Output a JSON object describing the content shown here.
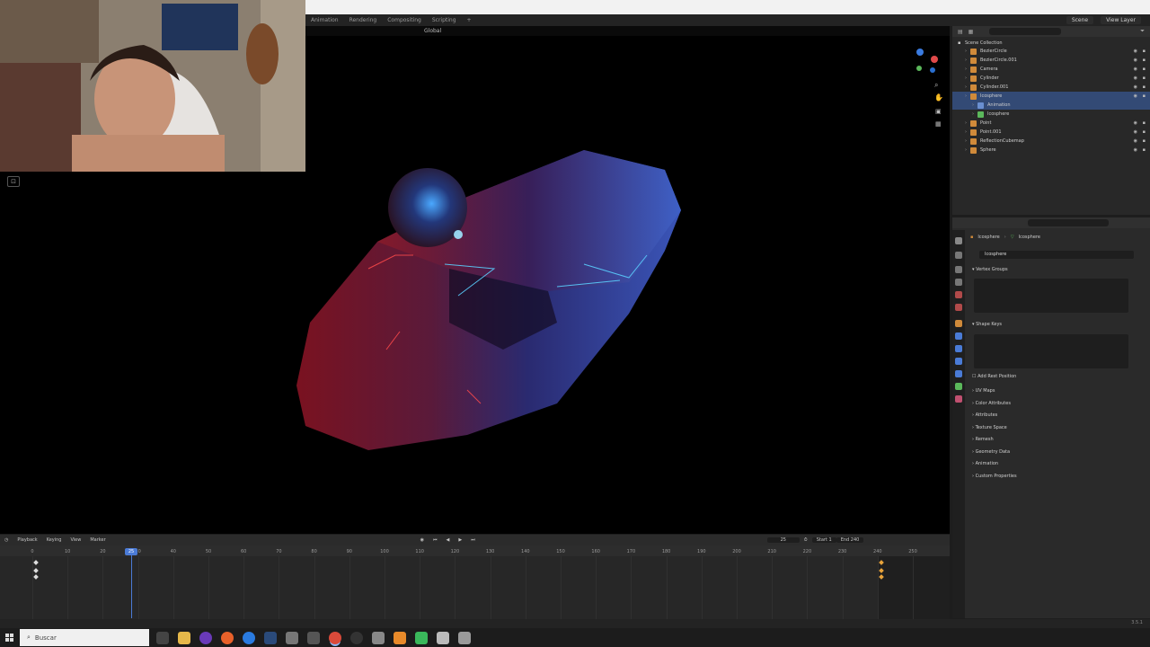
{
  "menubar": {
    "tabs": [
      "Animation",
      "Rendering",
      "Compositing",
      "Scripting",
      "+"
    ],
    "scene": "Scene",
    "view_layer": "View Layer"
  },
  "viewport_header": {
    "transform": "Global"
  },
  "outliner": {
    "search_placeholder": "",
    "root": "Scene Collection",
    "items": [
      {
        "name": "BezierCircle",
        "color": "#d08a3a",
        "selected": false,
        "level": 1
      },
      {
        "name": "BezierCircle.001",
        "color": "#d08a3a",
        "selected": false,
        "level": 1
      },
      {
        "name": "Camera",
        "color": "#d08a3a",
        "selected": false,
        "level": 1
      },
      {
        "name": "Cylinder",
        "color": "#d08a3a",
        "selected": false,
        "level": 1
      },
      {
        "name": "Cylinder.001",
        "color": "#d08a3a",
        "selected": false,
        "level": 1
      },
      {
        "name": "Icosphere",
        "color": "#d08a3a",
        "selected": true,
        "level": 1
      },
      {
        "name": "Animation",
        "color": "#6a8fd0",
        "selected": true,
        "level": 2
      },
      {
        "name": "Icosphere",
        "color": "#5bb85b",
        "selected": false,
        "level": 2
      },
      {
        "name": "Point",
        "color": "#d08a3a",
        "selected": false,
        "level": 1
      },
      {
        "name": "Point.001",
        "color": "#d08a3a",
        "selected": false,
        "level": 1
      },
      {
        "name": "ReflectionCubemap",
        "color": "#d08a3a",
        "selected": false,
        "level": 1
      },
      {
        "name": "Sphere",
        "color": "#d08a3a",
        "selected": false,
        "level": 1
      }
    ]
  },
  "properties": {
    "breadcrumb_object": "Icosphere",
    "breadcrumb_data": "Icosphere",
    "data_name": "Icosphere",
    "panels": {
      "vertex_groups": "Vertex Groups",
      "shape_keys": "Shape Keys",
      "add_rest_position": "Add Rest Position",
      "uv_maps": "UV Maps",
      "color_attributes": "Color Attributes",
      "attributes": "Attributes",
      "texture_space": "Texture Space",
      "remesh": "Remesh",
      "geometry_data": "Geometry Data",
      "animation": "Animation",
      "custom_properties": "Custom Properties"
    }
  },
  "timeline": {
    "menu": [
      "Playback",
      "Keying",
      "View",
      "Marker"
    ],
    "current_frame": "25",
    "start_label": "Start",
    "start_value": "1",
    "end_label": "End",
    "end_value": "240",
    "playhead": "25",
    "ticks": [
      "0",
      "10",
      "20",
      "30",
      "40",
      "50",
      "60",
      "70",
      "80",
      "90",
      "100",
      "110",
      "120",
      "130",
      "140",
      "150",
      "160",
      "170",
      "180",
      "190",
      "200",
      "210",
      "220",
      "230",
      "240",
      "250"
    ]
  },
  "statusbar": {
    "version": "3.5.1"
  },
  "taskbar": {
    "search_placeholder": "Buscar"
  }
}
